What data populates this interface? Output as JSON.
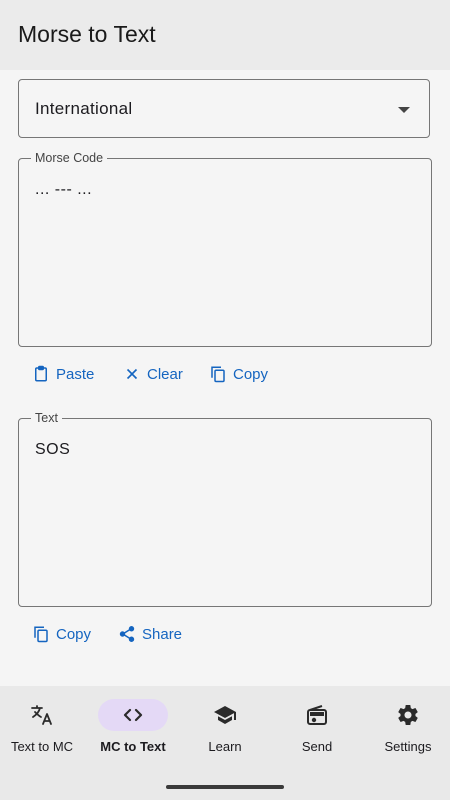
{
  "app_bar": {
    "title": "Morse to Text"
  },
  "language_select": {
    "value": "International"
  },
  "morse_field": {
    "label": "Morse Code",
    "value": "... --- ..."
  },
  "morse_actions": {
    "paste": "Paste",
    "clear": "Clear",
    "copy": "Copy"
  },
  "text_field": {
    "label": "Text",
    "value": "SOS"
  },
  "text_actions": {
    "copy": "Copy",
    "share": "Share"
  },
  "bottom_nav": {
    "items": [
      {
        "label": "Text to MC",
        "icon": "translate-icon"
      },
      {
        "label": "MC to Text",
        "icon": "code-icon",
        "active": true
      },
      {
        "label": "Learn",
        "icon": "school-icon"
      },
      {
        "label": "Send",
        "icon": "radio-icon"
      },
      {
        "label": "Settings",
        "icon": "gear-icon"
      }
    ]
  },
  "colors": {
    "accent": "#1565c0",
    "active_pill": "#e4d9f6",
    "app_bar": "#ebebeb",
    "background": "#f5f5f5"
  }
}
